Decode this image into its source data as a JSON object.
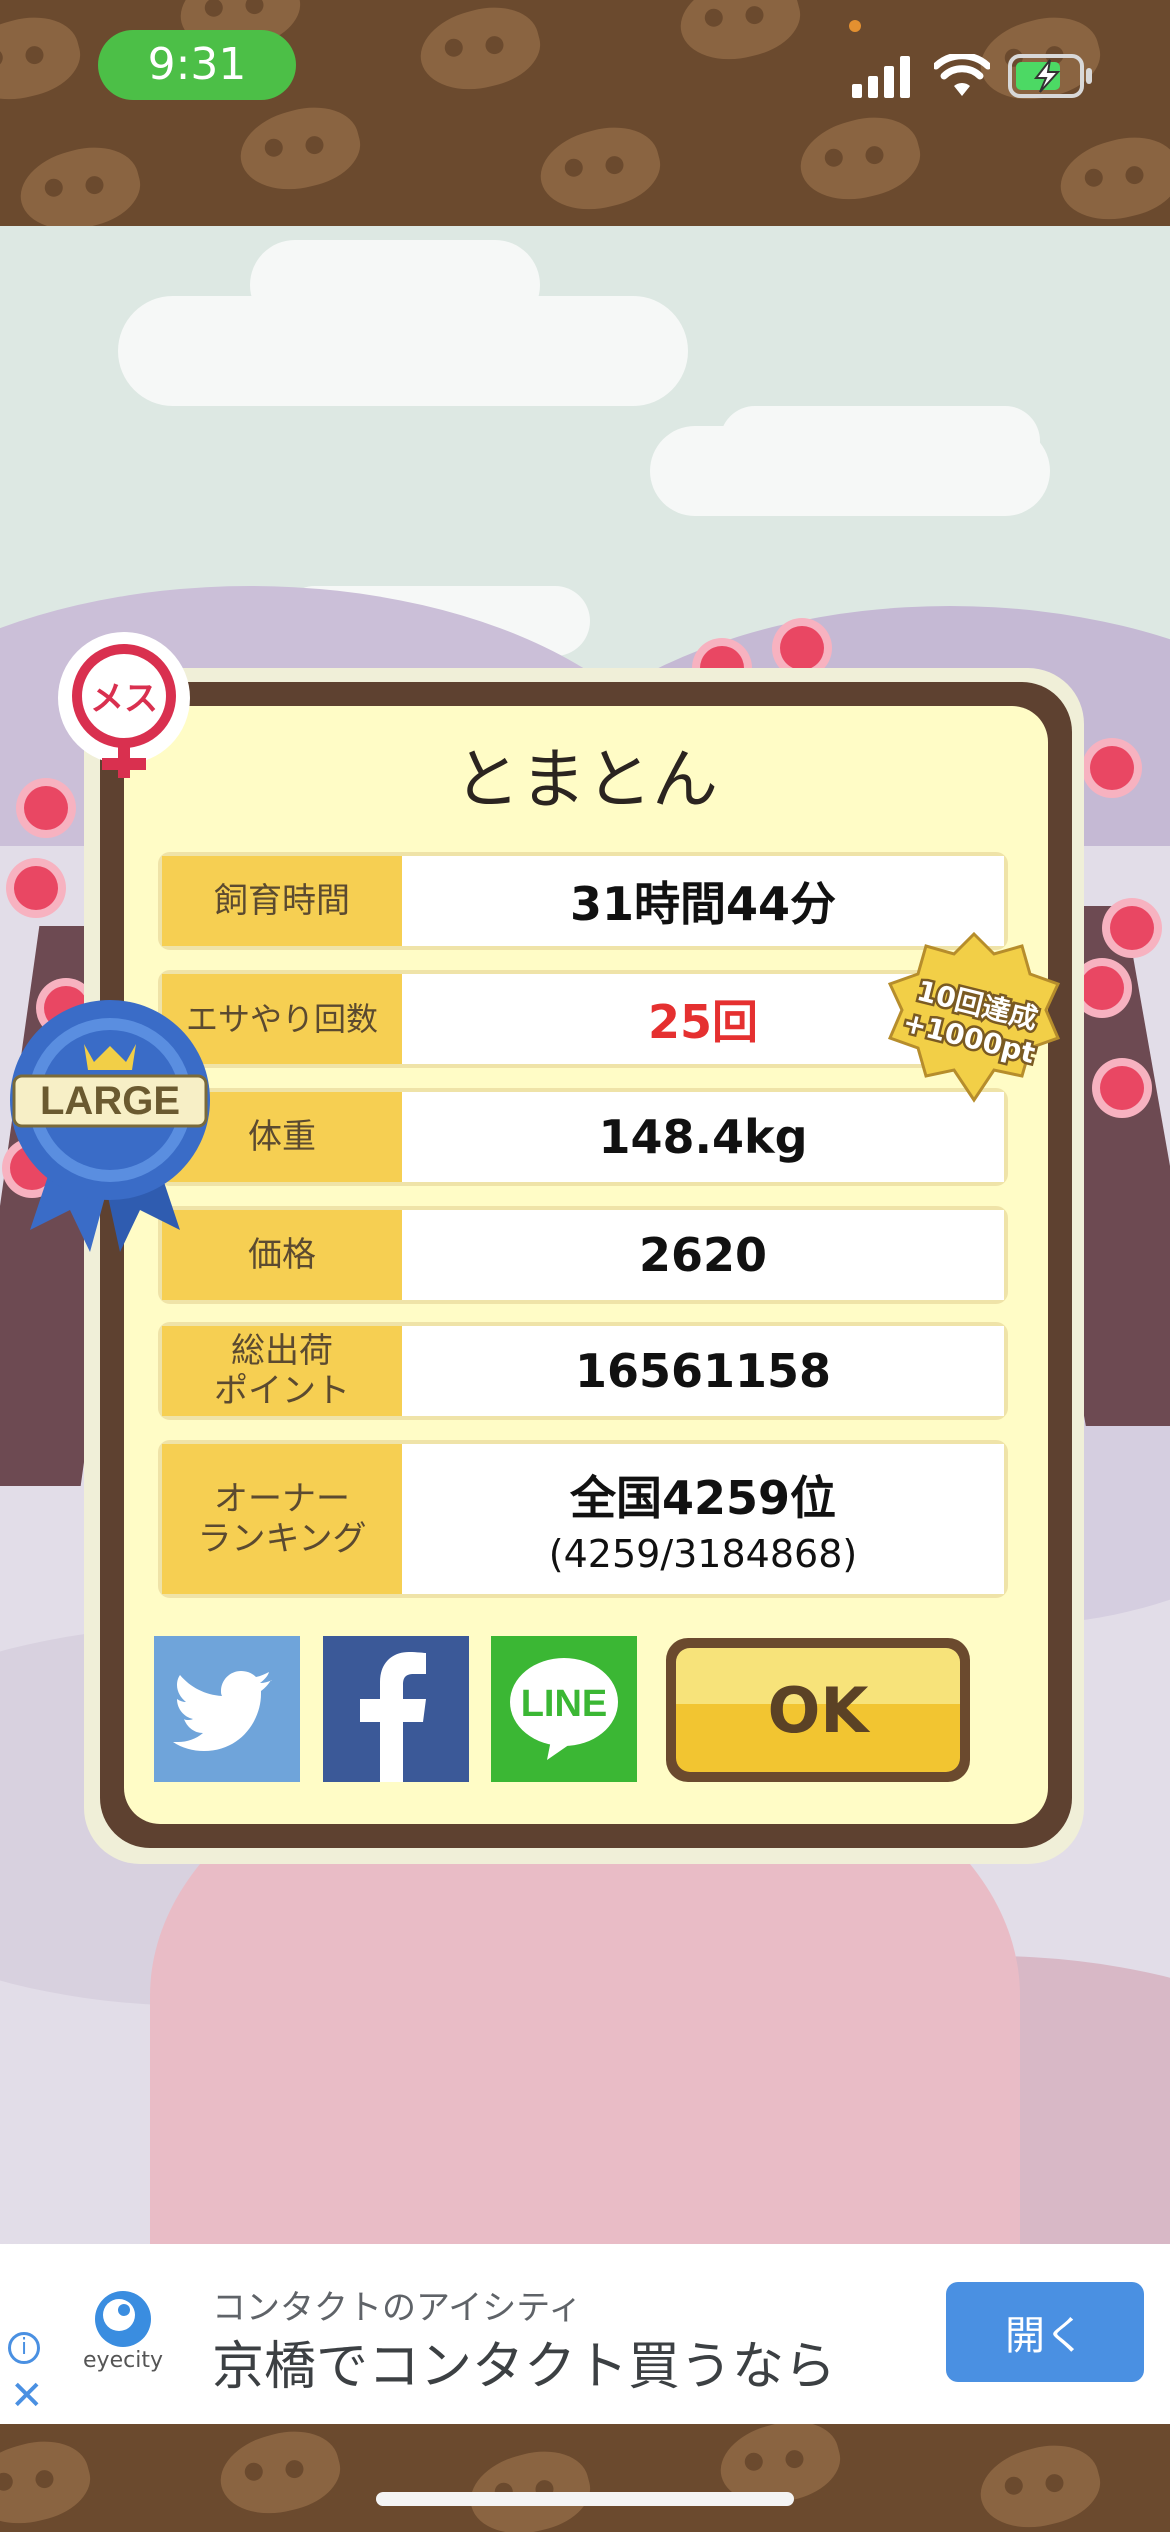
{
  "status_bar": {
    "time": "9:31"
  },
  "dialog": {
    "pig_name": "とまとん",
    "rows": [
      {
        "label": "飼育時間",
        "value": "31時間44分"
      },
      {
        "label": "エサやり回数",
        "value": "25回"
      },
      {
        "label": "体重",
        "value": "148.4kg"
      },
      {
        "label": "価格",
        "value": "2620"
      },
      {
        "label": "総出荷\nポイント",
        "value": "16561158"
      },
      {
        "label": "オーナー\nランキング",
        "value": "全国4259位",
        "sub": "(4259/3184868)"
      }
    ],
    "gender_badge": "メス",
    "size_badge": "LARGE",
    "bonus_badge": {
      "line1": "10回達成",
      "line2": "+1000pt"
    },
    "ok_label": "OK",
    "share": {
      "line": "LINE"
    }
  },
  "ad": {
    "subtitle": "コンタクトのアイシティ",
    "title": "京橋でコンタクト買うなら",
    "brand": "eyecity",
    "open_label": "開く"
  },
  "colors": {
    "brown_frame": "#5e4130",
    "card_bg": "#fffcc6",
    "label_bg": "#f6cf52",
    "highlight_red": "#e53030",
    "twitter": "#6fa4da",
    "facebook": "#3b5998",
    "line": "#3bb734",
    "ad_button": "#4a90e2"
  }
}
